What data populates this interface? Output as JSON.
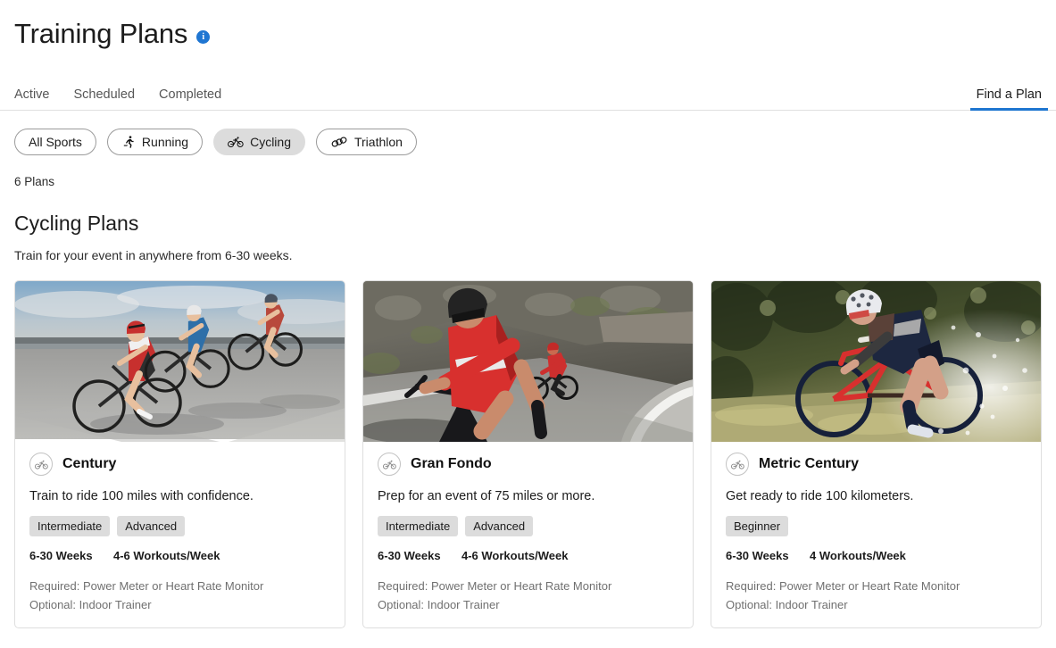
{
  "header": {
    "title": "Training Plans",
    "info_icon": "info-icon",
    "info_label": "i"
  },
  "tabs": {
    "left": [
      {
        "label": "Active",
        "active": false
      },
      {
        "label": "Scheduled",
        "active": false
      },
      {
        "label": "Completed",
        "active": false
      }
    ],
    "right": {
      "label": "Find a Plan",
      "active": true,
      "underline_color": "#1e76d0"
    }
  },
  "sport_filters": [
    {
      "label": "All Sports",
      "icon": "",
      "selected": false
    },
    {
      "label": "Running",
      "icon": "running-icon",
      "selected": false
    },
    {
      "label": "Cycling",
      "icon": "cycling-icon",
      "selected": true
    },
    {
      "label": "Triathlon",
      "icon": "triathlon-rings-icon",
      "selected": false
    }
  ],
  "plans_count": "6 Plans",
  "section": {
    "title": "Cycling Plans",
    "subtitle": "Train for your event in anywhere from 6-30 weeks."
  },
  "cards": [
    {
      "title": "Century",
      "icon": "cycling-icon",
      "description": "Train to ride 100 miles with confidence.",
      "levels": [
        "Intermediate",
        "Advanced"
      ],
      "weeks": "6-30 Weeks",
      "workouts": "4-6 Workouts/Week",
      "required": "Required: Power Meter or Heart Rate Monitor",
      "optional": "Optional: Indoor Trainer",
      "image_alt": "three-road-cyclists-on-highway"
    },
    {
      "title": "Gran Fondo",
      "icon": "cycling-icon",
      "description": "Prep for an event of 75 miles or more.",
      "levels": [
        "Intermediate",
        "Advanced"
      ],
      "weeks": "6-30 Weeks",
      "workouts": "4-6 Workouts/Week",
      "required": "Required: Power Meter or Heart Rate Monitor",
      "optional": "Optional: Indoor Trainer",
      "image_alt": "two-cyclists-in-red-on-mountain-road-curve"
    },
    {
      "title": "Metric Century",
      "icon": "cycling-icon",
      "description": "Get ready to ride 100 kilometers.",
      "levels": [
        "Beginner"
      ],
      "weeks": "6-30 Weeks",
      "workouts": "4 Workouts/Week",
      "required": "Required: Power Meter or Heart Rate Monitor",
      "optional": "Optional: Indoor Trainer",
      "image_alt": "female-gravel-cyclist-splashing-water"
    }
  ],
  "colors": {
    "accent_blue": "#1e76d0",
    "chip_gray": "#dcdcdc",
    "muted_text": "#707070",
    "border": "#dedede"
  }
}
